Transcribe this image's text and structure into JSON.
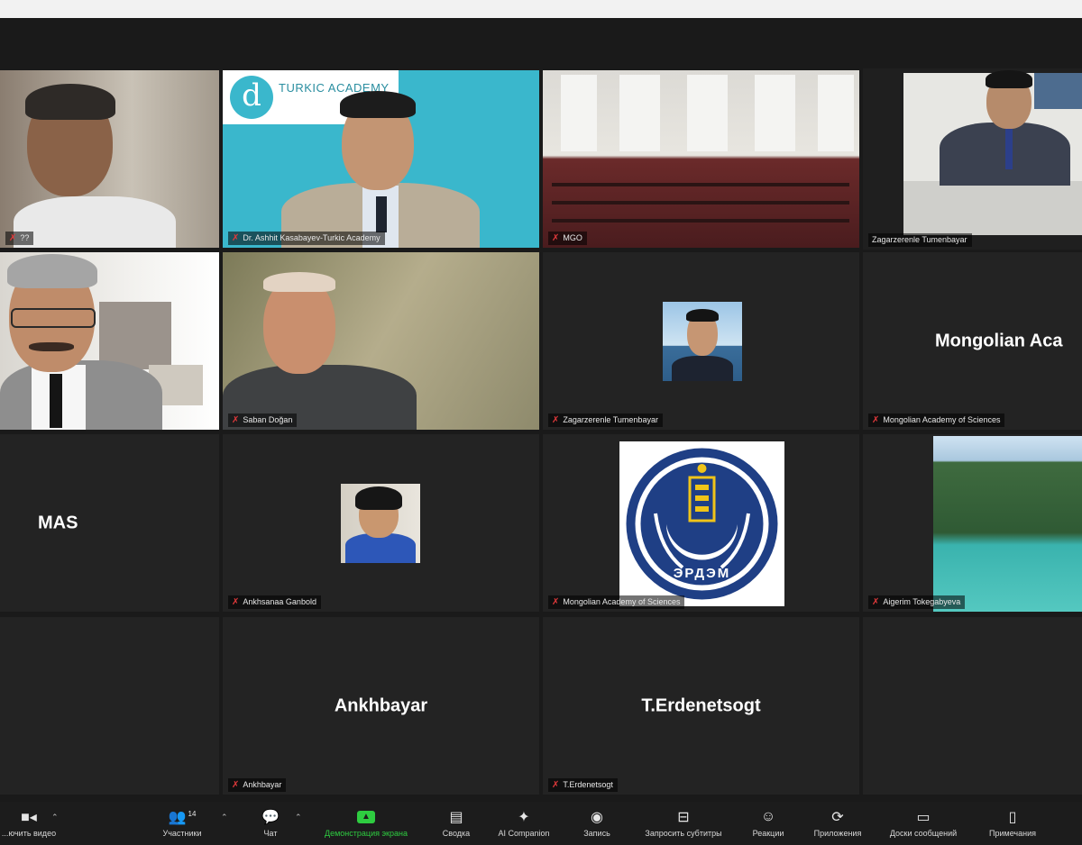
{
  "participants": [
    {
      "id": "t1",
      "label": "??"
    },
    {
      "id": "t2",
      "label": "Dr. Ashhit Kasabayev-Turkic Academy",
      "logo_text": "TURKIC ACADEMY"
    },
    {
      "id": "t3",
      "label": "MGO"
    },
    {
      "id": "t4",
      "label": "Zagarzerenle Tumenbayar"
    },
    {
      "id": "t5",
      "label": ""
    },
    {
      "id": "t6",
      "label": "Saban Doğan"
    },
    {
      "id": "t7",
      "label": "Zagarzerenle Tumenbayar"
    },
    {
      "id": "t8",
      "label": "Mongolian Academy of Sciences",
      "big_name": "Mongolian  Aca"
    },
    {
      "id": "t9",
      "label": "",
      "big_name": "MAS"
    },
    {
      "id": "t10",
      "label": "Ankhsanaa Ganbold"
    },
    {
      "id": "t11",
      "label": "Mongolian Academy of Sciences",
      "seal_text": "ЭРДЭМ"
    },
    {
      "id": "t12",
      "label": "Aigerim Tokegabyeva"
    },
    {
      "id": "t13",
      "label": ""
    },
    {
      "id": "t14",
      "label": "Ankhbayar",
      "big_name": "Ankhbayar"
    },
    {
      "id": "t15",
      "label": "T.Erdenetsogt",
      "big_name": "T.Erdenetsogt"
    },
    {
      "id": "t16",
      "label": ""
    }
  ],
  "toolbar": {
    "video": "...ючить видео",
    "participants": "Участники",
    "participants_count": "14",
    "chat": "Чат",
    "share": "Демонстрация экрана",
    "summary": "Сводка",
    "companion": "AI Companion",
    "record": "Запись",
    "captions": "Запросить субтитры",
    "reactions": "Реакции",
    "apps": "Приложения",
    "whiteboards": "Доски сообщений",
    "notes": "Примечания"
  },
  "colors": {
    "active_border": "#a9d13c",
    "mic_muted": "#e0393b",
    "share_green": "#2ecc40",
    "turkic_bg": "#3ab7cc"
  }
}
